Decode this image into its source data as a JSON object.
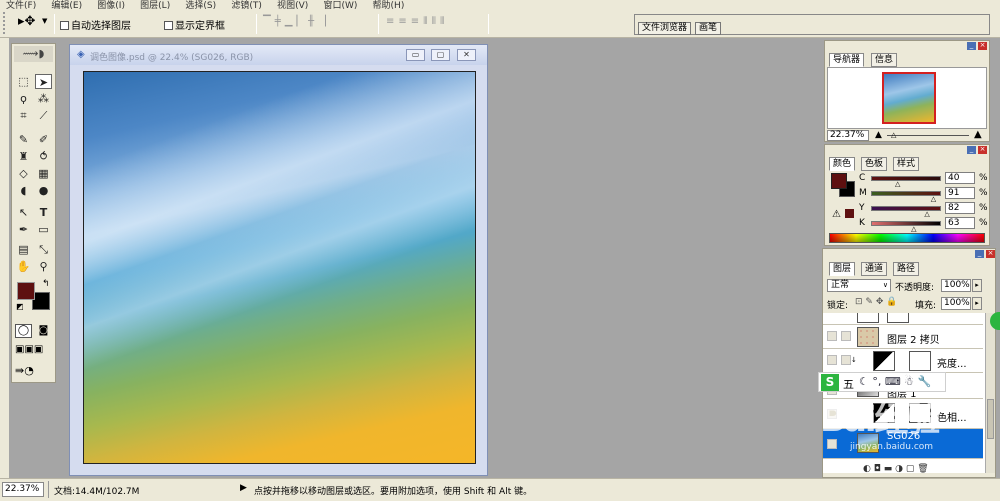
{
  "menu": [
    "文件(F)",
    "编辑(E)",
    "图像(I)",
    "图层(L)",
    "选择(S)",
    "滤镜(T)",
    "视图(V)",
    "窗口(W)",
    "帮助(H)"
  ],
  "options": {
    "auto_select_label": "自动选择图层",
    "show_bounds_label": "显示定界框",
    "well_tabs": [
      "文件浏览器",
      "画笔"
    ]
  },
  "document": {
    "title": "调色图像.psd @ 22.4% (SG026, RGB)",
    "minimize": "▭",
    "maximize": "▢",
    "close": "✕"
  },
  "navigator": {
    "tabs": [
      "导航器",
      "信息"
    ],
    "zoom": "22.37%"
  },
  "color": {
    "tabs": [
      "颜色",
      "色板",
      "样式"
    ],
    "channels": [
      {
        "label": "C",
        "value": "40",
        "unit": "%",
        "pos": 0.4
      },
      {
        "label": "M",
        "value": "91",
        "unit": "%",
        "pos": 0.91
      },
      {
        "label": "Y",
        "value": "82",
        "unit": "%",
        "pos": 0.82
      },
      {
        "label": "K",
        "value": "63",
        "unit": "%",
        "pos": 0.63
      }
    ],
    "foreground": "#5e1010",
    "background": "#000000"
  },
  "layers": {
    "tabs": [
      "图层",
      "通道",
      "路径"
    ],
    "blend_mode": "正常",
    "opacity_label": "不透明度:",
    "opacity": "100%",
    "lock_label": "锁定:",
    "fill_label": "填充:",
    "fill": "100%",
    "rows": [
      {
        "name": "图层 2 拷贝"
      },
      {
        "name": "亮度..."
      },
      {
        "name": "图层 1"
      },
      {
        "name": "色相..."
      },
      {
        "name": "SG026"
      }
    ]
  },
  "status": {
    "zoom": "22.37%",
    "doc": "文档:14.4M/102.7M",
    "hint": "点按并拖移以移动图层或选区。要用附加选项，使用 Shift 和 Alt 键。"
  },
  "ime": {
    "label": "五"
  },
  "watermark": {
    "text": "Bai经验",
    "url": "jingyan.baidu.com"
  }
}
